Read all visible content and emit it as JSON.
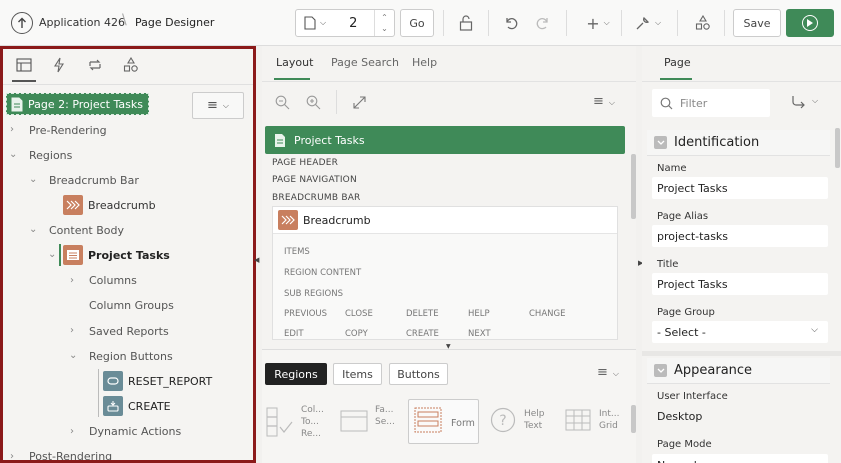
{
  "header": {
    "app_label": "Application 426",
    "page_title": "Page Designer",
    "page_number": "2",
    "go_label": "Go",
    "save_label": "Save"
  },
  "left": {
    "selected_node": "Page 2: Project Tasks",
    "tree": {
      "pre_rendering": "Pre-Rendering",
      "regions": "Regions",
      "breadcrumb_bar": "Breadcrumb Bar",
      "breadcrumb": "Breadcrumb",
      "content_body": "Content Body",
      "project_tasks": "Project Tasks",
      "columns": "Columns",
      "column_groups": "Column Groups",
      "saved_reports": "Saved Reports",
      "region_buttons": "Region Buttons",
      "reset_report": "RESET_REPORT",
      "create": "CREATE",
      "dynamic_actions": "Dynamic Actions",
      "post_rendering": "Post-Rendering"
    }
  },
  "center": {
    "tabs": [
      "Layout",
      "Page Search",
      "Help"
    ],
    "page_banner": "Project Tasks",
    "positions": [
      "PAGE HEADER",
      "PAGE NAVIGATION",
      "BREADCRUMB BAR"
    ],
    "breadcrumb_region": "Breadcrumb",
    "sub_positions": [
      "ITEMS",
      "REGION CONTENT",
      "SUB REGIONS"
    ],
    "button_positions": [
      "PREVIOUS",
      "CLOSE",
      "DELETE",
      "HELP",
      "CHANGE",
      "EDIT",
      "COPY",
      "CREATE",
      "NEXT"
    ],
    "gallery_tabs": [
      "Regions",
      "Items",
      "Buttons"
    ],
    "gallery_items": [
      {
        "line1": "Col...",
        "line2": "To...",
        "line3": "Re..."
      },
      {
        "line1": "Fa...",
        "line2": "Se..."
      },
      {
        "line1": "Form"
      },
      {
        "line1": "Help",
        "line2": "Text"
      },
      {
        "line1": "Int...",
        "line2": "Grid"
      }
    ]
  },
  "right": {
    "tab": "Page",
    "filter_placeholder": "Filter",
    "identification": {
      "title": "Identification",
      "name_label": "Name",
      "name_value": "Project Tasks",
      "alias_label": "Page Alias",
      "alias_value": "project-tasks",
      "title_label": "Title",
      "title_value": "Project Tasks",
      "group_label": "Page Group",
      "group_value": "- Select -"
    },
    "appearance": {
      "title": "Appearance",
      "ui_label": "User Interface",
      "ui_value": "Desktop",
      "mode_label": "Page Mode",
      "mode_value": "Normal"
    }
  },
  "colors": {
    "accent_green": "#3f8a58",
    "border_red": "#8b1a1a",
    "region_icon": "#c87f5f",
    "button_icon": "#6a8c97"
  }
}
